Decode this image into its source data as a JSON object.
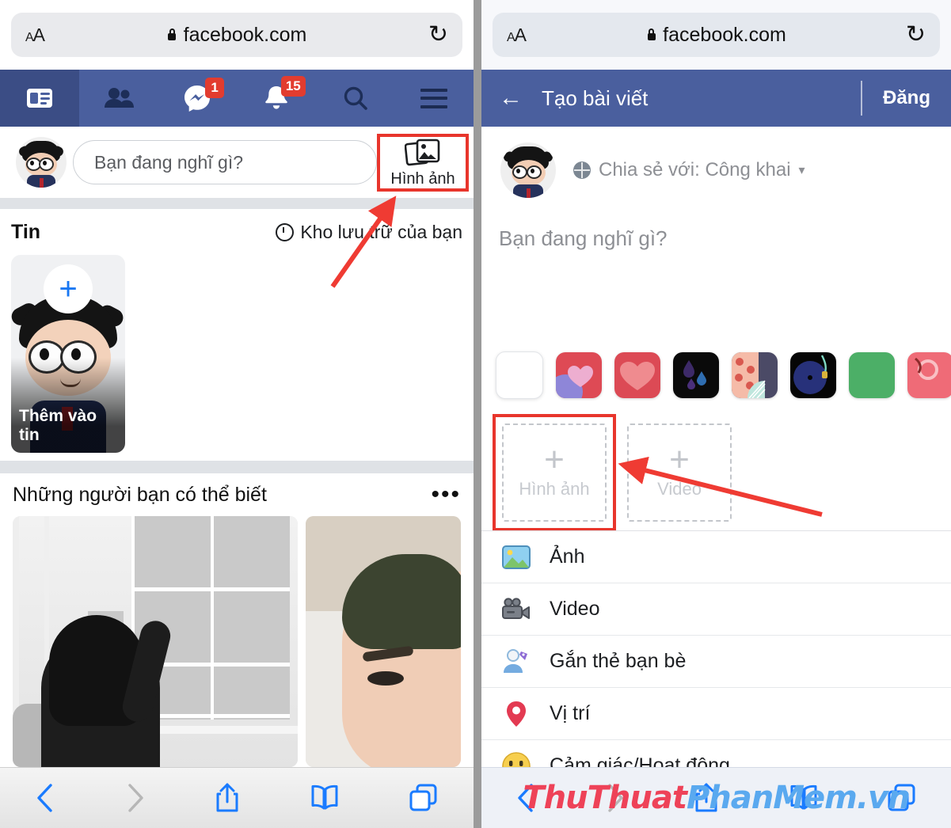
{
  "browser": {
    "text_size_label": "AA",
    "url": "facebook.com",
    "lock_icon": "lock-icon",
    "reload_icon": "reload-icon",
    "toolbar": {
      "back_icon": "back-chevron-icon",
      "forward_icon": "forward-chevron-icon",
      "share_icon": "share-icon",
      "bookmarks_icon": "book-icon",
      "tabs_icon": "tabs-icon"
    }
  },
  "left_panel": {
    "nav_tabs": [
      {
        "name": "news-feed",
        "icon": "newsfeed-icon",
        "active": true,
        "badge": ""
      },
      {
        "name": "friends",
        "icon": "friends-icon",
        "active": false,
        "badge": ""
      },
      {
        "name": "messenger",
        "icon": "messenger-icon",
        "active": false,
        "badge": "1"
      },
      {
        "name": "notifications",
        "icon": "bell-icon",
        "active": false,
        "badge": "15"
      },
      {
        "name": "search",
        "icon": "search-icon",
        "active": false,
        "badge": ""
      },
      {
        "name": "menu",
        "icon": "hamburger-icon",
        "active": false,
        "badge": ""
      }
    ],
    "composer": {
      "placeholder": "Bạn đang nghĩ gì?",
      "photo_button_label": "Hình ảnh",
      "photo_button_icon": "photos-icon",
      "highlighted": true
    },
    "stories": {
      "title": "Tin",
      "archive_label": "Kho lưu trữ của bạn",
      "archive_icon": "clock-icon",
      "add_story_label": "Thêm vào tin",
      "add_story_plus": "+"
    },
    "pymk": {
      "title": "Những người bạn có thể biết",
      "more_icon": "more-dots-icon"
    }
  },
  "right_panel": {
    "header": {
      "back_icon": "back-arrow-icon",
      "title": "Tạo bài viết",
      "post_label": "Đăng"
    },
    "audience": {
      "icon": "globe-icon",
      "label": "Chia sẻ với: Công khai",
      "caret": "▾"
    },
    "status_placeholder": "Bạn đang nghĩ gì?",
    "background_swatches": [
      {
        "name": "no-background",
        "color": "#ffffff"
      },
      {
        "name": "hearts-purple",
        "color": "#de4a55"
      },
      {
        "name": "big-heart-red",
        "color": "#dc4a55"
      },
      {
        "name": "dark-drops",
        "color": "#0a0a0a"
      },
      {
        "name": "pink-fan",
        "color": "#4b4a66"
      },
      {
        "name": "vinyl-record",
        "color": "#060606"
      },
      {
        "name": "solid-green",
        "color": "#4caf67"
      },
      {
        "name": "pink-flamingo",
        "color": "#ef6b77"
      }
    ],
    "media_boxes": [
      {
        "name": "add-photo-box",
        "label": "Hình ảnh",
        "plus": "+",
        "highlighted": true
      },
      {
        "name": "add-video-box",
        "label": "Video",
        "plus": "+",
        "highlighted": false
      }
    ],
    "menu_items": [
      {
        "name": "menu-photo",
        "label": "Ảnh",
        "icon": "photo-icon"
      },
      {
        "name": "menu-video",
        "label": "Video",
        "icon": "video-camera-icon"
      },
      {
        "name": "menu-tag-friends",
        "label": "Gắn thẻ bạn bè",
        "icon": "tag-friend-icon"
      },
      {
        "name": "menu-location",
        "label": "Vị trí",
        "icon": "location-pin-icon"
      },
      {
        "name": "menu-feeling",
        "label": "Cảm giác/Hoạt động",
        "icon": "smiley-icon"
      }
    ]
  },
  "watermark": {
    "part_red": "ThuThuat",
    "part_blue": "PhanMem.vn"
  },
  "colors": {
    "fb_blue": "#4a5f9e",
    "fb_blue_active": "#3b4d85",
    "badge_red": "#e23c2f",
    "highlight_red": "#e8352c",
    "safari_blue": "#1a7bff"
  }
}
